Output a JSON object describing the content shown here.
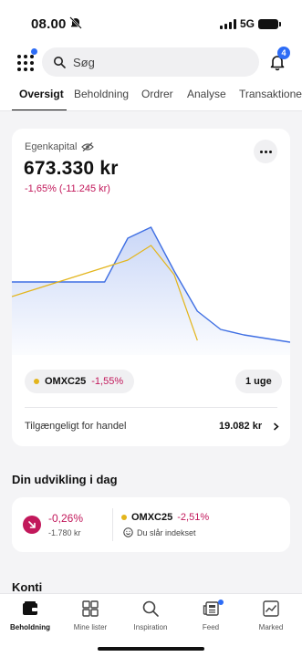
{
  "status_bar": {
    "time": "08.00",
    "network": "5G"
  },
  "search": {
    "placeholder": "Søg"
  },
  "notifications": {
    "count": "4"
  },
  "tabs": [
    {
      "label": "Oversigt",
      "active": true
    },
    {
      "label": "Beholdning"
    },
    {
      "label": "Ordrer"
    },
    {
      "label": "Analyse"
    },
    {
      "label": "Transaktioner"
    }
  ],
  "equity": {
    "label": "Egenkapital",
    "value": "673.330 kr",
    "change": "-1,65% (-11.245 kr)"
  },
  "benchmark": {
    "name": "OMXC25",
    "change": "-1,55%"
  },
  "period": "1 uge",
  "available": {
    "label": "Tilgængeligt for handel",
    "value": "19.082 kr"
  },
  "development": {
    "title": "Din udvikling i dag",
    "pct": "-0,26%",
    "amount": "-1.780 kr",
    "bench_name": "OMXC25",
    "bench_change": "-2,51%",
    "beat_text": "Du slår indekset"
  },
  "accounts": {
    "title": "Konti"
  },
  "bottom_nav": [
    {
      "label": "Beholdning",
      "icon": "wallet-icon",
      "active": true
    },
    {
      "label": "Mine lister",
      "icon": "grid-icon"
    },
    {
      "label": "Inspiration",
      "icon": "search-icon"
    },
    {
      "label": "Feed",
      "icon": "newspaper-icon"
    },
    {
      "label": "Marked",
      "icon": "chart-icon"
    }
  ],
  "colors": {
    "accent": "#2d6cf6",
    "negative": "#c2185b",
    "benchmark": "#e3b51c",
    "portfolio_line": "#3f6fe3"
  },
  "chart_data": {
    "type": "line",
    "x": [
      0,
      1,
      2,
      3,
      4,
      5,
      6,
      7,
      8,
      9,
      10,
      11,
      12
    ],
    "series": [
      {
        "values": [
          0.0,
          0.0,
          0.0,
          0.0,
          0.0,
          1.2,
          1.5,
          0.3,
          -0.8,
          -1.3,
          -1.45,
          -1.55,
          -1.65
        ]
      },
      {
        "values": [
          -0.4,
          -0.2,
          0.0,
          0.2,
          0.4,
          0.6,
          1.0,
          0.2,
          -1.6,
          null,
          null,
          null,
          null
        ]
      }
    ],
    "ylim": [
      -2.0,
      2.0
    ]
  }
}
